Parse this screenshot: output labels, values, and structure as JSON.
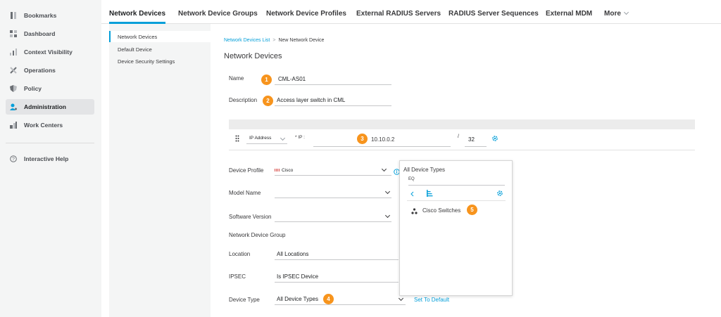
{
  "left_nav": {
    "items": [
      {
        "label": "Bookmarks",
        "icon": "bookmark-icon"
      },
      {
        "label": "Dashboard",
        "icon": "dashboard-icon"
      },
      {
        "label": "Context Visibility",
        "icon": "context-visibility-icon"
      },
      {
        "label": "Operations",
        "icon": "operations-icon"
      },
      {
        "label": "Policy",
        "icon": "policy-icon"
      },
      {
        "label": "Administration",
        "icon": "administration-icon",
        "active": true
      },
      {
        "label": "Work Centers",
        "icon": "work-centers-icon"
      }
    ],
    "help": {
      "label": "Interactive Help",
      "icon": "help-icon"
    }
  },
  "tabs": [
    {
      "label": "Network Devices",
      "active": true
    },
    {
      "label": "Network Device Groups"
    },
    {
      "label": "Network Device Profiles"
    },
    {
      "label": "External RADIUS Servers"
    },
    {
      "label": "RADIUS Server Sequences"
    },
    {
      "label": "External MDM"
    },
    {
      "label": "More"
    }
  ],
  "subnav": {
    "items": [
      {
        "label": "Network Devices",
        "active": true
      },
      {
        "label": "Default Device"
      },
      {
        "label": "Device Security Settings"
      }
    ]
  },
  "breadcrumb": {
    "link": "Network Devices List",
    "separator": ">",
    "current": "New Network Device"
  },
  "page_title": "Network Devices",
  "form": {
    "name_label": "Name",
    "name_value": "CML-AS01",
    "description_label": "Description",
    "description_value": "Access layer switch in CML",
    "ip_type": "IP Address",
    "ip_label": "* IP :",
    "ip_value": "10.10.0.2",
    "mask_sep": "/",
    "mask_value": "32",
    "device_profile_label": "Device Profile",
    "device_profile_value": "Cisco",
    "model_name_label": "Model Name",
    "model_name_value": "",
    "software_version_label": "Software Version",
    "software_version_value": "",
    "ndg_label": "Network Device Group",
    "location_label": "Location",
    "location_value": "All Locations",
    "ipsec_label": "IPSEC",
    "ipsec_value": "Is IPSEC Device",
    "device_type_label": "Device Type",
    "device_type_value": "All Device Types",
    "set_to_default": "Set To Default"
  },
  "badges": [
    "1",
    "2",
    "3",
    "4",
    "5"
  ],
  "popup": {
    "title": "All Device Types",
    "search_placeholder": "EQ",
    "item": "Cisco Switches"
  },
  "colors": {
    "accent": "#049fd9",
    "badge": "#f7941d",
    "nav_bg": "#f4f5f5"
  }
}
